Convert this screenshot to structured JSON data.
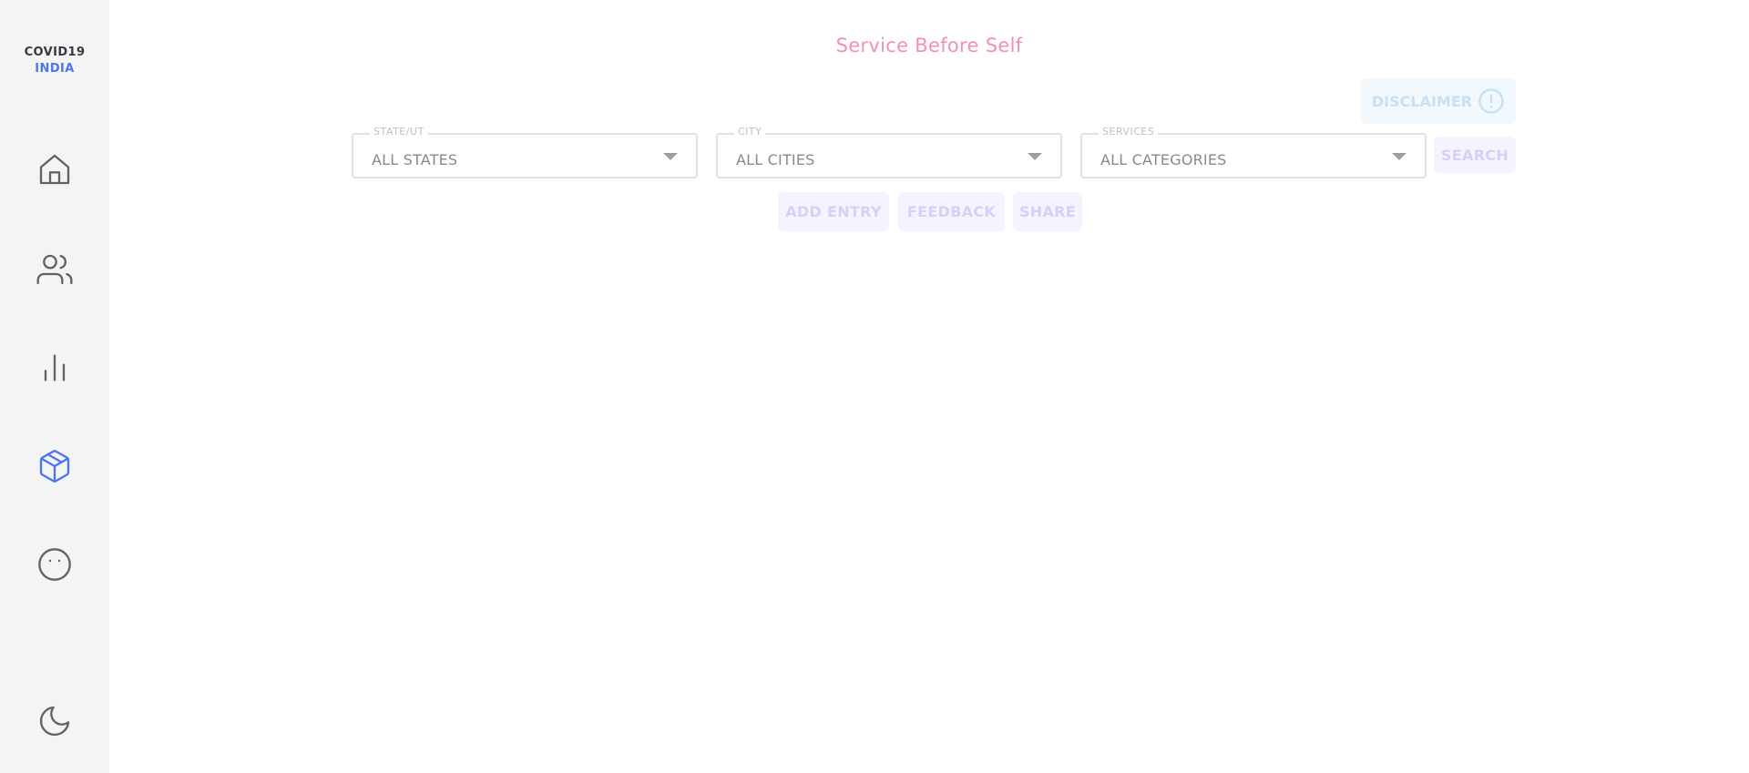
{
  "brand": {
    "line1": "COVID19",
    "line2": "INDIA"
  },
  "sidebar": {
    "items": [
      {
        "icon": "home-icon",
        "active": false
      },
      {
        "icon": "users-icon",
        "active": false
      },
      {
        "icon": "bar-chart-icon",
        "active": false
      },
      {
        "icon": "package-icon",
        "active": true
      },
      {
        "icon": "face-icon",
        "active": false
      }
    ],
    "theme_toggle_icon": "moon-icon"
  },
  "header": {
    "tagline": "Service Before Self"
  },
  "disclaimer": {
    "label": "DISCLAIMER",
    "icon": "info-circle-icon"
  },
  "filters": {
    "state": {
      "label": "STATE/UT",
      "value": "ALL STATES"
    },
    "city": {
      "label": "CITY",
      "value": "ALL CITIES"
    },
    "services": {
      "label": "SERVICES",
      "value": "ALL CATEGORIES"
    }
  },
  "actions": {
    "search": "SEARCH",
    "add_entry": "ADD ENTRY",
    "feedback": "FEEDBACK",
    "share": "SHARE"
  },
  "colors": {
    "sidebar_bg": "#f4f4f4",
    "accent": "#4c75f2",
    "tagline": "#f48fb1",
    "icon": "#5f6368"
  }
}
